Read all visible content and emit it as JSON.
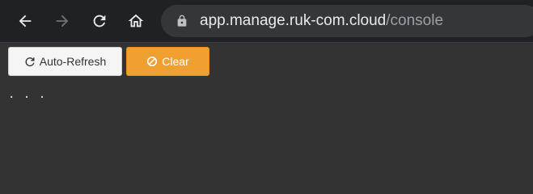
{
  "browser": {
    "url_host": "app.manage.ruk-com.cloud",
    "url_path": "/console",
    "icons": {
      "back": "arrow-left-icon",
      "forward": "arrow-right-icon",
      "reload": "reload-icon",
      "home": "home-icon",
      "lock": "lock-icon"
    }
  },
  "console": {
    "auto_refresh_label": "Auto-Refresh",
    "clear_label": "Clear",
    "output_text": ". . .",
    "icons": {
      "refresh": "refresh-icon",
      "clear": "ban-icon"
    }
  },
  "colors": {
    "toolbar_bg": "#202124",
    "urlbar_bg": "#35363a",
    "page_bg": "#333333",
    "clear_button": "#f0a030",
    "refresh_button": "#f5f5f5"
  }
}
